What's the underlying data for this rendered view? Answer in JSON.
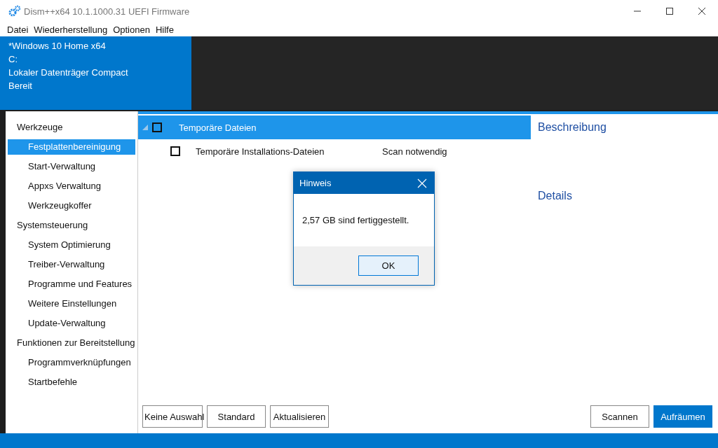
{
  "window": {
    "title": "Dism++x64 10.1.1000.31 UEFI Firmware"
  },
  "menu": [
    "Datei",
    "Wiederherstellung",
    "Optionen",
    "Hilfe"
  ],
  "image_info": [
    "*Windows 10 Home x64",
    "C:",
    "Lokaler Datenträger Compact",
    "Bereit"
  ],
  "sidebar": [
    {
      "label": "Werkzeuge",
      "items": [
        {
          "label": "Festplattenbereinigung",
          "selected": true
        },
        {
          "label": "Start-Verwaltung",
          "selected": false
        },
        {
          "label": "Appxs Verwaltung",
          "selected": false
        },
        {
          "label": "Werkzeugkoffer",
          "selected": false
        }
      ]
    },
    {
      "label": "Systemsteuerung",
      "items": [
        {
          "label": "System Optimierung",
          "selected": false
        },
        {
          "label": "Treiber-Verwaltung",
          "selected": false
        },
        {
          "label": "Programme und Features",
          "selected": false
        },
        {
          "label": "Weitere Einstellungen",
          "selected": false
        },
        {
          "label": "Update-Verwaltung",
          "selected": false
        }
      ]
    },
    {
      "label": "Funktionen zur Bereitstellung",
      "items": [
        {
          "label": "Programmverknüpfungen",
          "selected": false
        },
        {
          "label": "Startbefehle",
          "selected": false
        }
      ]
    }
  ],
  "tree": [
    {
      "label": "Temporäre Dateien",
      "selected": true,
      "checked": false,
      "expanded": true,
      "children": [
        {
          "label": "Temporäre Installations-Dateien",
          "status": "Scan notwendig",
          "checked": false,
          "selected": false
        }
      ]
    }
  ],
  "info_panel": {
    "description_heading": "Beschreibung",
    "details_heading": "Details"
  },
  "buttons_left": [
    "Keine Auswahl",
    "Standard",
    "Aktualisieren"
  ],
  "buttons_right": [
    {
      "label": "Scannen",
      "kind": "default"
    },
    {
      "label": "Aufräumen",
      "kind": "primary"
    }
  ],
  "dialog": {
    "title": "Hinweis",
    "message": "2,57 GB sind fertiggestellt.",
    "button": "OK"
  }
}
